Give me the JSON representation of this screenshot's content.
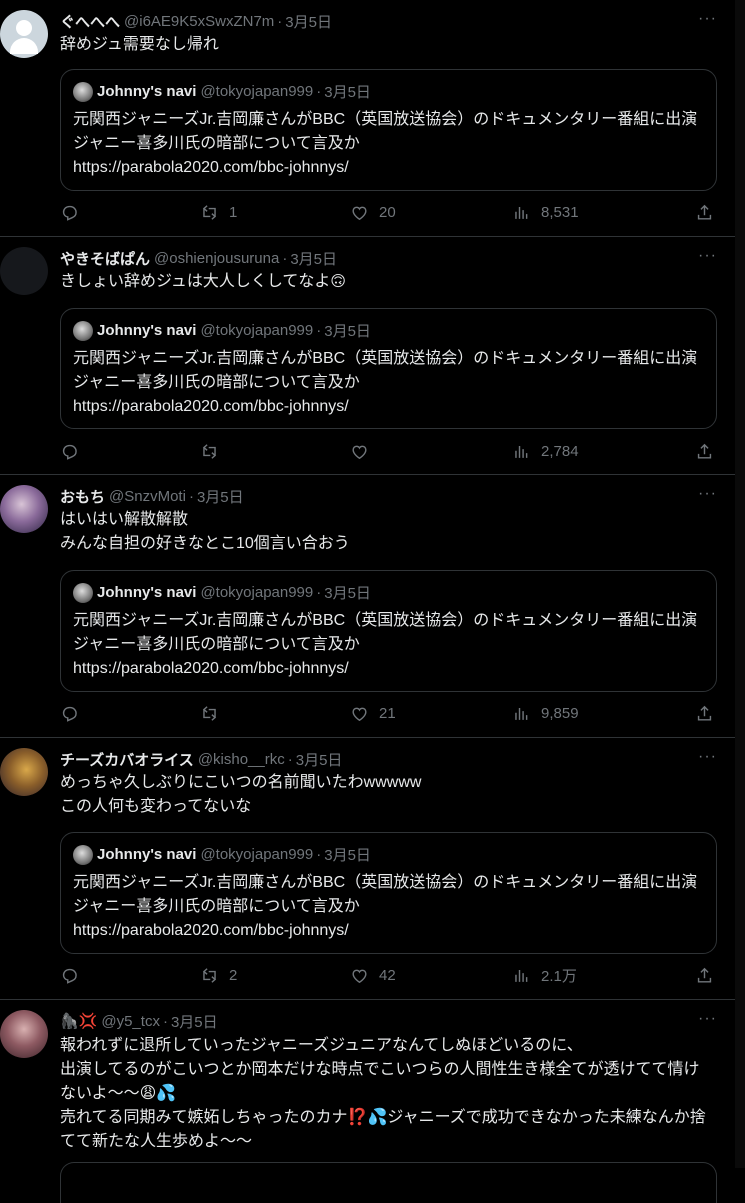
{
  "quote_common": {
    "name": "Johnny's navi",
    "handle": "@tokyojapan999",
    "date": "3月5日",
    "text": "元関西ジャニーズJr.吉岡廉さんがBBC（英国放送協会）のドキュメンタリー番組に出演　ジャニー喜多川氏の暗部について言及か\nhttps://parabola2020.com/bbc-johnnys/"
  },
  "tweets": [
    {
      "name": "ぐへへへ",
      "handle": "@i6AE9K5xSwxZN7m",
      "date": "3月5日",
      "text": "辞めジュ需要なし帰れ",
      "replies": "",
      "retweets": "1",
      "likes": "20",
      "views": "8,531"
    },
    {
      "name": "やきそばぱん",
      "handle": "@oshienjousuruna",
      "date": "3月5日",
      "text": "きしょい辞めジュは大人しくしてなよ",
      "emoji": "🙃",
      "replies": "",
      "retweets": "",
      "likes": "",
      "views": "2,784"
    },
    {
      "name": "おもち",
      "handle": "@SnzvMoti",
      "date": "3月5日",
      "text": "はいはい解散解散\nみんな自担の好きなとこ10個言い合おう",
      "replies": "",
      "retweets": "",
      "likes": "21",
      "views": "9,859"
    },
    {
      "name": "チーズカバオライス",
      "handle": "@kisho__rkc",
      "date": "3月5日",
      "text": "めっちゃ久しぶりにこいつの名前聞いたわwwwww\nこの人何も変わってないな",
      "replies": "",
      "retweets": "2",
      "likes": "42",
      "views": "2.1万"
    },
    {
      "name": "🦍💢",
      "handle": "@y5_tcx",
      "date": "3月5日",
      "text": "報われずに退所していったジャニーズジュニアなんてしぬほどいるのに、\n出演してるのがこいつとか岡本だけな時点でこいつらの人間性生き様全てが透けてて情けないよ〜〜😩💦\n売れてる同期みて嫉妬しちゃったのカナ⁉️💦ジャニーズで成功できなかった未練なんか捨てて新たな人生歩めよ〜〜"
    }
  ],
  "more_glyph": "···",
  "colors": {
    "background": "#000000",
    "text": "#e7e9ea",
    "muted": "#71767b",
    "border": "#2f3336"
  },
  "icons": [
    "reply-icon",
    "retweet-icon",
    "like-icon",
    "views-icon",
    "share-icon",
    "more-icon"
  ]
}
